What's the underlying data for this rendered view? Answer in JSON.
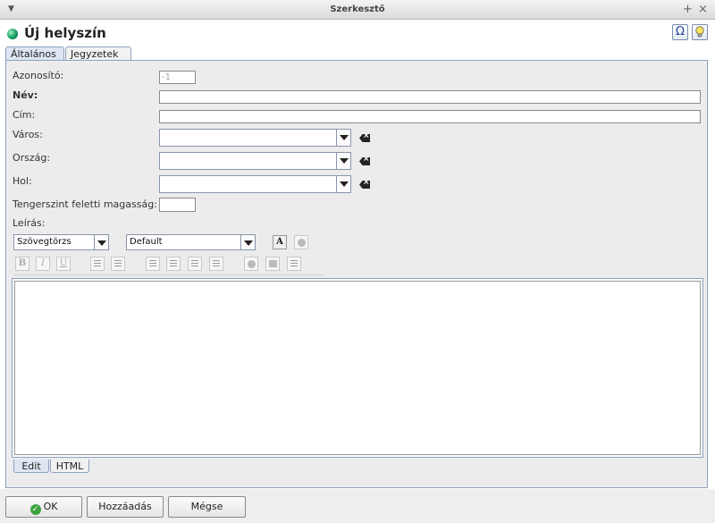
{
  "window": {
    "title": "Szerkesztő"
  },
  "header": {
    "title": "Új helyszín",
    "special_char_symbol": "Ω"
  },
  "tabs": [
    {
      "label": "Általános",
      "active": true
    },
    {
      "label": "Jegyzetek",
      "active": false
    }
  ],
  "form": {
    "id": {
      "label": "Azonosító:",
      "value": "-1"
    },
    "name": {
      "label": "Név:",
      "value": ""
    },
    "address": {
      "label": "Cím:",
      "value": ""
    },
    "city": {
      "label": "Város:",
      "value": ""
    },
    "country": {
      "label": "Ország:",
      "value": ""
    },
    "where": {
      "label": "Hol:",
      "value": ""
    },
    "altitude": {
      "label": "Tengerszint feletti magasság:",
      "value": ""
    },
    "description": {
      "label": "Leírás:"
    }
  },
  "editor": {
    "style_select": "Szövegtörzs",
    "font_select": "Default",
    "bold": "B",
    "italic": "I",
    "underline": "U",
    "tabs": [
      {
        "label": "Edit",
        "active": true
      },
      {
        "label": "HTML",
        "active": false
      }
    ],
    "content": ""
  },
  "buttons": {
    "ok": "OK",
    "add": "Hozzáadás",
    "cancel": "Mégse"
  }
}
